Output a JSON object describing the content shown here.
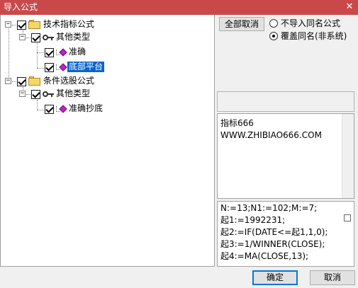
{
  "window": {
    "title": "导入公式",
    "close_glyph": "✕"
  },
  "tree": {
    "nodes": [
      {
        "label": "技术指标公式",
        "expander": "−"
      },
      {
        "label": "其他类型",
        "expander": "−"
      },
      {
        "label": "准确"
      },
      {
        "label": "底部平台",
        "selected": true
      },
      {
        "label": "条件选股公式",
        "expander": "−"
      },
      {
        "label": "其他类型",
        "expander": "−"
      },
      {
        "label": "准确抄底"
      }
    ]
  },
  "options": {
    "select_all_button": "全部取消",
    "radio_skip": "不导入同名公式",
    "radio_overwrite": "覆盖同名(非系统)",
    "selected_radio": "radio_overwrite"
  },
  "description": {
    "lines": [
      "指标666",
      "WWW.ZHIBIAO666.COM"
    ]
  },
  "code": {
    "lines": [
      "N:=13;N1:=102;M:=7;",
      "起1:=1992231;",
      "起2:=IF(DATE<=起1,1,0);",
      "起3:=1/WINNER(CLOSE);",
      "起4:=MA(CLOSE,13);"
    ]
  },
  "footer": {
    "ok_button": "确定",
    "cancel_button": "取消"
  },
  "colors": {
    "titlebar": "#c9494a",
    "selection": "#0a64cf",
    "formula_icon": "#c51fcf",
    "folder": "#f5d66b"
  },
  "icons": {
    "folder": "folder-icon",
    "category": "key-icon",
    "formula": "formula-icon",
    "close": "close-icon"
  }
}
